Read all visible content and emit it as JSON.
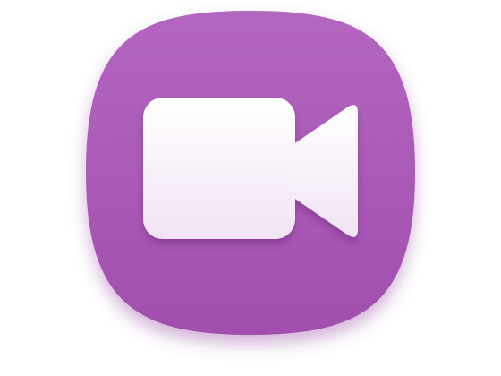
{
  "app_icon": {
    "name": "video-camera-app",
    "glyph": "video-camera-icon",
    "colors": {
      "tile_top": "#b366c0",
      "tile_bottom": "#a24eae",
      "tile_shadow": "#9c55a6",
      "glyph_top": "#ffffff",
      "glyph_bottom": "#f1e3f4",
      "glyph_shadow": "#6b2a76"
    }
  }
}
